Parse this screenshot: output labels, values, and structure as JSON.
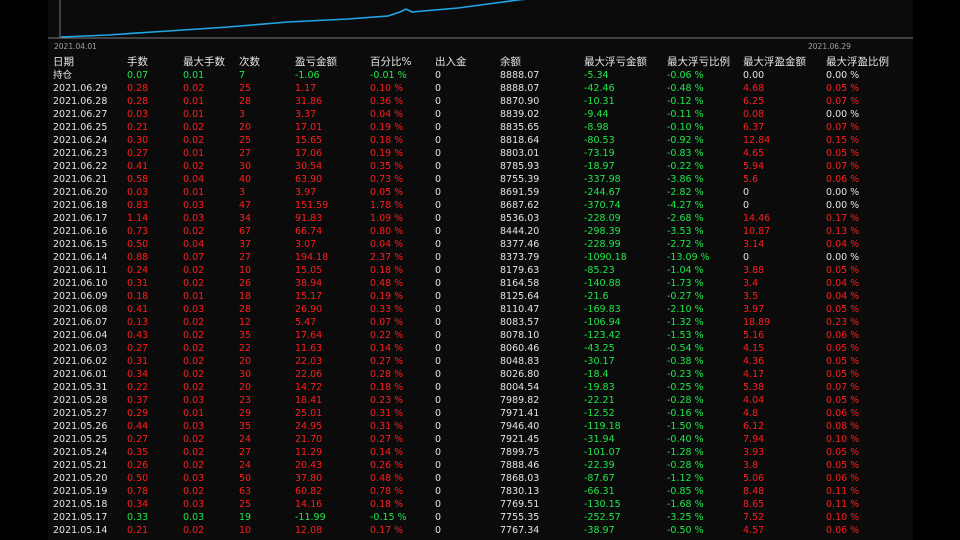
{
  "colors": {
    "background": "#000000",
    "panel": "#0b0b0b",
    "profit": "#21e64a",
    "loss": "#ff1e1e",
    "text": "#e4e4e4",
    "curve": "#1fa8e8"
  },
  "chart": {
    "x_start_label": "2021.04.01",
    "x_end_label": "2021.06.29"
  },
  "headers": [
    "日期",
    "手数",
    "最大手数",
    "次数",
    "盈亏金额",
    "百分比%",
    "出入金",
    "余额",
    "最大浮亏金额",
    "最大浮亏比例",
    "最大浮盈金额",
    "最大浮盈比例"
  ],
  "holding_row": [
    "持仓",
    "0.07",
    "0.01",
    "7",
    "-1.06",
    "-0.01 %",
    "0",
    "8888.07",
    "-5.34",
    "-0.06 %",
    "0.00",
    "0.00 %"
  ],
  "rows": [
    [
      "2021.06.29",
      "0.28",
      "0.02",
      "25",
      "1.17",
      "0.10 %",
      "0",
      "8888.07",
      "-42.46",
      "-0.48 %",
      "4.68",
      "0.05 %"
    ],
    [
      "2021.06.28",
      "0.28",
      "0.01",
      "28",
      "31.86",
      "0.36 %",
      "0",
      "8870.90",
      "-10.31",
      "-0.12 %",
      "6.25",
      "0.07 %"
    ],
    [
      "2021.06.27",
      "0.03",
      "0.01",
      "3",
      "3.37",
      "0.04 %",
      "0",
      "8839.02",
      "-9.44",
      "-0.11 %",
      "0.08",
      "0.00 %"
    ],
    [
      "2021.06.25",
      "0.21",
      "0.02",
      "20",
      "17.01",
      "0.19 %",
      "0",
      "8835.65",
      "-8.98",
      "-0.10 %",
      "6.37",
      "0.07 %"
    ],
    [
      "2021.06.24",
      "0.30",
      "0.02",
      "25",
      "15.65",
      "0.18 %",
      "0",
      "8818.64",
      "-80.53",
      "-0.92 %",
      "12.84",
      "0.15 %"
    ],
    [
      "2021.06.23",
      "0.27",
      "0.01",
      "27",
      "17.06",
      "0.19 %",
      "0",
      "8803.01",
      "-73.19",
      "-0.83 %",
      "4.65",
      "0.05 %"
    ],
    [
      "2021.06.22",
      "0.41",
      "0.02",
      "30",
      "30.54",
      "0.35 %",
      "0",
      "8785.93",
      "-18.97",
      "-0.22 %",
      "5.94",
      "0.07 %"
    ],
    [
      "2021.06.21",
      "0.58",
      "0.04",
      "40",
      "63.90",
      "0.73 %",
      "0",
      "8755.39",
      "-337.98",
      "-3.86 %",
      "5.6",
      "0.06 %"
    ],
    [
      "2021.06.20",
      "0.03",
      "0.01",
      "3",
      "3.97",
      "0.05 %",
      "0",
      "8691.59",
      "-244.67",
      "-2.82 %",
      "0",
      "0.00 %"
    ],
    [
      "2021.06.18",
      "0.83",
      "0.03",
      "47",
      "151.59",
      "1.78 %",
      "0",
      "8687.62",
      "-370.74",
      "-4.27 %",
      "0",
      "0.00 %"
    ],
    [
      "2021.06.17",
      "1.14",
      "0.03",
      "34",
      "91.83",
      "1.09 %",
      "0",
      "8536.03",
      "-228.09",
      "-2.68 %",
      "14.46",
      "0.17 %"
    ],
    [
      "2021.06.16",
      "0.73",
      "0.02",
      "67",
      "66.74",
      "0.80 %",
      "0",
      "8444.20",
      "-298.39",
      "-3.53 %",
      "10.87",
      "0.13 %"
    ],
    [
      "2021.06.15",
      "0.50",
      "0.04",
      "37",
      "3.07",
      "0.04 %",
      "0",
      "8377.46",
      "-228.99",
      "-2.72 %",
      "3.14",
      "0.04 %"
    ],
    [
      "2021.06.14",
      "0.88",
      "0.07",
      "27",
      "194.18",
      "2.37 %",
      "0",
      "8373.79",
      "-1090.18",
      "-13.09 %",
      "0",
      "0.00 %"
    ],
    [
      "2021.06.11",
      "0.24",
      "0.02",
      "10",
      "15.05",
      "0.18 %",
      "0",
      "8179.63",
      "-85.23",
      "-1.04 %",
      "3.88",
      "0.05 %"
    ],
    [
      "2021.06.10",
      "0.31",
      "0.02",
      "26",
      "38.94",
      "0.48 %",
      "0",
      "8164.58",
      "-140.88",
      "-1.73 %",
      "3.4",
      "0.04 %"
    ],
    [
      "2021.06.09",
      "0.18",
      "0.01",
      "18",
      "15.17",
      "0.19 %",
      "0",
      "8125.64",
      "-21.6",
      "-0.27 %",
      "3.5",
      "0.04 %"
    ],
    [
      "2021.06.08",
      "0.41",
      "0.03",
      "28",
      "26.90",
      "0.33 %",
      "0",
      "8110.47",
      "-169.83",
      "-2.10 %",
      "3.97",
      "0.05 %"
    ],
    [
      "2021.06.07",
      "0.13",
      "0.02",
      "12",
      "5.47",
      "0.07 %",
      "0",
      "8083.57",
      "-106.94",
      "-1.32 %",
      "18.89",
      "0.23 %"
    ],
    [
      "2021.06.04",
      "0.43",
      "0.02",
      "35",
      "17.64",
      "0.22 %",
      "0",
      "8078.10",
      "-123.42",
      "-1.53 %",
      "5.16",
      "0.06 %"
    ],
    [
      "2021.06.03",
      "0.27",
      "0.02",
      "22",
      "11.63",
      "0.14 %",
      "0",
      "8060.46",
      "-43.25",
      "-0.54 %",
      "4.15",
      "0.05 %"
    ],
    [
      "2021.06.02",
      "0.31",
      "0.02",
      "20",
      "22.03",
      "0.27 %",
      "0",
      "8048.83",
      "-30.17",
      "-0.38 %",
      "4.36",
      "0.05 %"
    ],
    [
      "2021.06.01",
      "0.34",
      "0.02",
      "30",
      "22.06",
      "0.28 %",
      "0",
      "8026.80",
      "-18.4",
      "-0.23 %",
      "4.17",
      "0.05 %"
    ],
    [
      "2021.05.31",
      "0.22",
      "0.02",
      "20",
      "14.72",
      "0.18 %",
      "0",
      "8004.54",
      "-19.83",
      "-0.25 %",
      "5.38",
      "0.07 %"
    ],
    [
      "2021.05.28",
      "0.37",
      "0.03",
      "23",
      "18.41",
      "0.23 %",
      "0",
      "7989.82",
      "-22.21",
      "-0.28 %",
      "4.04",
      "0.05 %"
    ],
    [
      "2021.05.27",
      "0.29",
      "0.01",
      "29",
      "25.01",
      "0.31 %",
      "0",
      "7971.41",
      "-12.52",
      "-0.16 %",
      "4.8",
      "0.06 %"
    ],
    [
      "2021.05.26",
      "0.44",
      "0.03",
      "35",
      "24.95",
      "0.31 %",
      "0",
      "7946.40",
      "-119.18",
      "-1.50 %",
      "6.12",
      "0.08 %"
    ],
    [
      "2021.05.25",
      "0.27",
      "0.02",
      "24",
      "21.70",
      "0.27 %",
      "0",
      "7921.45",
      "-31.94",
      "-0.40 %",
      "7.94",
      "0.10 %"
    ],
    [
      "2021.05.24",
      "0.35",
      "0.02",
      "27",
      "11.29",
      "0.14 %",
      "0",
      "7899.75",
      "-101.07",
      "-1.28 %",
      "3.93",
      "0.05 %"
    ],
    [
      "2021.05.21",
      "0.26",
      "0.02",
      "24",
      "20.43",
      "0.26 %",
      "0",
      "7888.46",
      "-22.39",
      "-0.28 %",
      "3.8",
      "0.05 %"
    ],
    [
      "2021.05.20",
      "0.50",
      "0.03",
      "50",
      "37.80",
      "0.48 %",
      "0",
      "7868.03",
      "-87.67",
      "-1.12 %",
      "5.06",
      "0.06 %"
    ],
    [
      "2021.05.19",
      "0.78",
      "0.02",
      "63",
      "60.82",
      "0.78 %",
      "0",
      "7830.13",
      "-66.31",
      "-0.85 %",
      "8.48",
      "0.11 %"
    ],
    [
      "2021.05.18",
      "0.34",
      "0.03",
      "25",
      "14.16",
      "0.18 %",
      "0",
      "7769.51",
      "-130.15",
      "-1.68 %",
      "8.65",
      "0.11 %"
    ],
    [
      "2021.05.17",
      "0.33",
      "0.03",
      "19",
      "-11.99",
      "-0.15 %",
      "0",
      "7755.35",
      "-252.57",
      "-3.25 %",
      "7.52",
      "0.10 %"
    ],
    [
      "2021.05.14",
      "0.21",
      "0.02",
      "10",
      "12.08",
      "0.17 %",
      "0",
      "7767.34",
      "-38.97",
      "-0.50 %",
      "4.57",
      "0.06 %"
    ]
  ]
}
